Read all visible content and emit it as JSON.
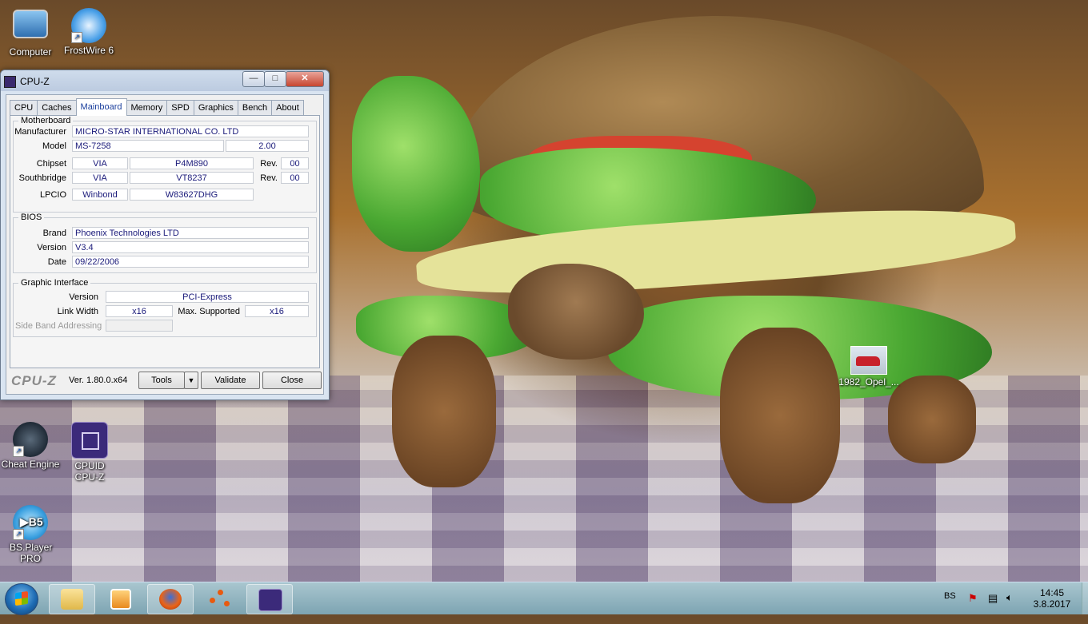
{
  "desktop": {
    "icons": [
      {
        "label": "Computer"
      },
      {
        "label": "FrostWire 6"
      },
      {
        "label": "Cheat Engine"
      },
      {
        "label": "CPUID CPU-Z"
      },
      {
        "label": "BS.Player PRO"
      },
      {
        "label": "1982_Opel_..."
      }
    ]
  },
  "window": {
    "title": "CPU-Z",
    "tabs": [
      "CPU",
      "Caches",
      "Mainboard",
      "Memory",
      "SPD",
      "Graphics",
      "Bench",
      "About"
    ],
    "active_tab": "Mainboard",
    "motherboard": {
      "legend": "Motherboard",
      "manufacturer_label": "Manufacturer",
      "manufacturer": "MICRO-STAR INTERNATIONAL CO. LTD",
      "model_label": "Model",
      "model": "MS-7258",
      "model_rev": "2.00",
      "chipset_label": "Chipset",
      "chipset_vendor": "VIA",
      "chipset_name": "P4M890",
      "rev_label": "Rev.",
      "chipset_rev": "00",
      "southbridge_label": "Southbridge",
      "southbridge_vendor": "VIA",
      "southbridge_name": "VT8237",
      "southbridge_rev": "00",
      "lpcio_label": "LPCIO",
      "lpcio_vendor": "Winbond",
      "lpcio_name": "W83627DHG"
    },
    "bios": {
      "legend": "BIOS",
      "brand_label": "Brand",
      "brand": "Phoenix Technologies LTD",
      "version_label": "Version",
      "version": "V3.4",
      "date_label": "Date",
      "date": "09/22/2006"
    },
    "graphic": {
      "legend": "Graphic Interface",
      "version_label": "Version",
      "version": "PCI-Express",
      "link_width_label": "Link Width",
      "link_width": "x16",
      "max_supported_label": "Max. Supported",
      "max_supported": "x16",
      "side_band_label": "Side Band Addressing",
      "side_band": ""
    },
    "footer": {
      "logo": "CPU-Z",
      "version": "Ver. 1.80.0.x64",
      "tools": "Tools",
      "validate": "Validate",
      "close": "Close"
    },
    "buttons": {
      "minimize": "—",
      "maximize": "□",
      "close": "✕"
    }
  },
  "taskbar": {
    "language": "BS",
    "time": "14:45",
    "date": "3.8.2017"
  }
}
